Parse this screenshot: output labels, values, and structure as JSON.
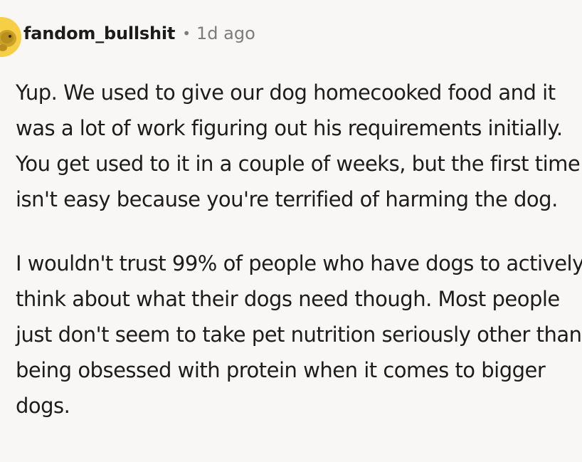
{
  "comment": {
    "author": "fandom_bullshit",
    "separator": "•",
    "timestamp": "1d ago",
    "avatar_icon": "dog-avatar-icon",
    "paragraphs": [
      "Yup. We used to give our dog homecooked food and it was a lot of work figuring out his requirements initially. You get used to it in a couple of weeks, but the first time isn't easy because you're terrified of harming the dog.",
      "I wouldn't trust 99% of people who have dogs to actively think about what their dogs need though. Most people just don't seem to take pet nutrition seriously other than being obsessed with protein when it comes to bigger dogs."
    ]
  },
  "colors": {
    "background": "#f8f7f5",
    "text": "#1c1c1c",
    "meta": "#7c7c7c",
    "avatar_bg": "#f7cf46"
  }
}
